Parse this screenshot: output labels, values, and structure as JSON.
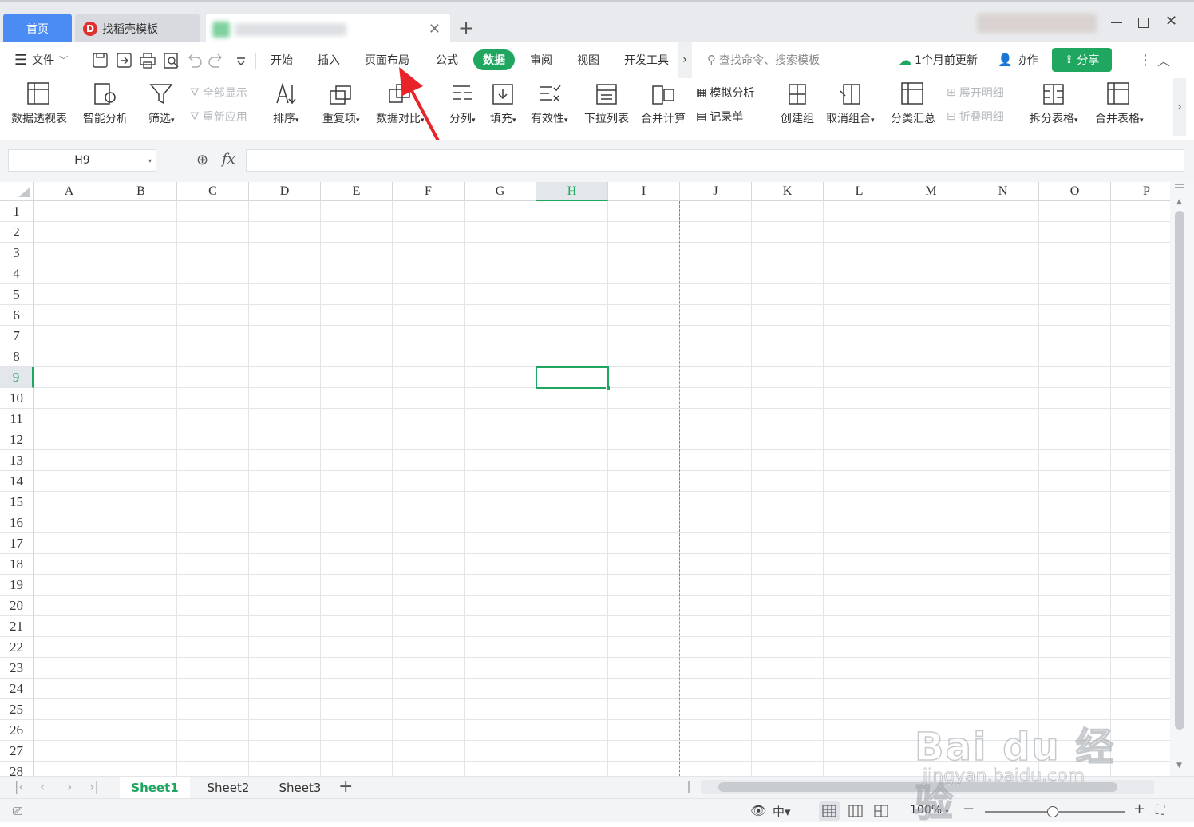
{
  "tabs": {
    "home": "首页",
    "template": "找稻壳模板"
  },
  "menu": {
    "file": "文件",
    "items": [
      "开始",
      "插入",
      "页面布局",
      "公式",
      "数据",
      "审阅",
      "视图",
      "开发工具"
    ],
    "search_placeholder": "查找命令、搜索模板",
    "updated": "1个月前更新",
    "collab": "协作",
    "share": "分享"
  },
  "ribbon": {
    "pivot": "数据透视表",
    "smart": "智能分析",
    "filter": "筛选",
    "show_all": "全部显示",
    "reapply": "重新应用",
    "sort": "排序",
    "dup": "重复项",
    "compare": "数据对比",
    "split": "分列",
    "fill": "填充",
    "valid": "有效性",
    "dropdown": "下拉列表",
    "merge_calc": "合并计算",
    "whatif": "模拟分析",
    "record": "记录单",
    "group": "创建组",
    "ungroup": "取消组合",
    "subtotal": "分类汇总",
    "expand": "展开明细",
    "collapse": "折叠明细",
    "split_table": "拆分表格",
    "merge_table": "合并表格"
  },
  "formula": {
    "cell_ref": "H9",
    "fx": "fx",
    "value": ""
  },
  "grid": {
    "columns": [
      "A",
      "B",
      "C",
      "D",
      "E",
      "F",
      "G",
      "H",
      "I",
      "J",
      "K",
      "L",
      "M",
      "N",
      "O",
      "P"
    ],
    "rows": [
      "1",
      "2",
      "3",
      "4",
      "5",
      "6",
      "7",
      "8",
      "9",
      "10",
      "11",
      "12",
      "13",
      "14",
      "15",
      "16",
      "17",
      "18",
      "19",
      "20",
      "21",
      "22",
      "23",
      "24",
      "25",
      "26",
      "27",
      "28"
    ],
    "selected_col": "H",
    "selected_row": "9"
  },
  "sheets": [
    "Sheet1",
    "Sheet2",
    "Sheet3"
  ],
  "active_sheet": "Sheet1",
  "status": {
    "zoom": "100%"
  },
  "watermark": {
    "brand": "Bai du 经验",
    "url": "jingyan.baidu.com"
  },
  "colors": {
    "accent": "#1fa760",
    "home_tab": "#4b8bf4",
    "arrow": "#e8232a"
  }
}
